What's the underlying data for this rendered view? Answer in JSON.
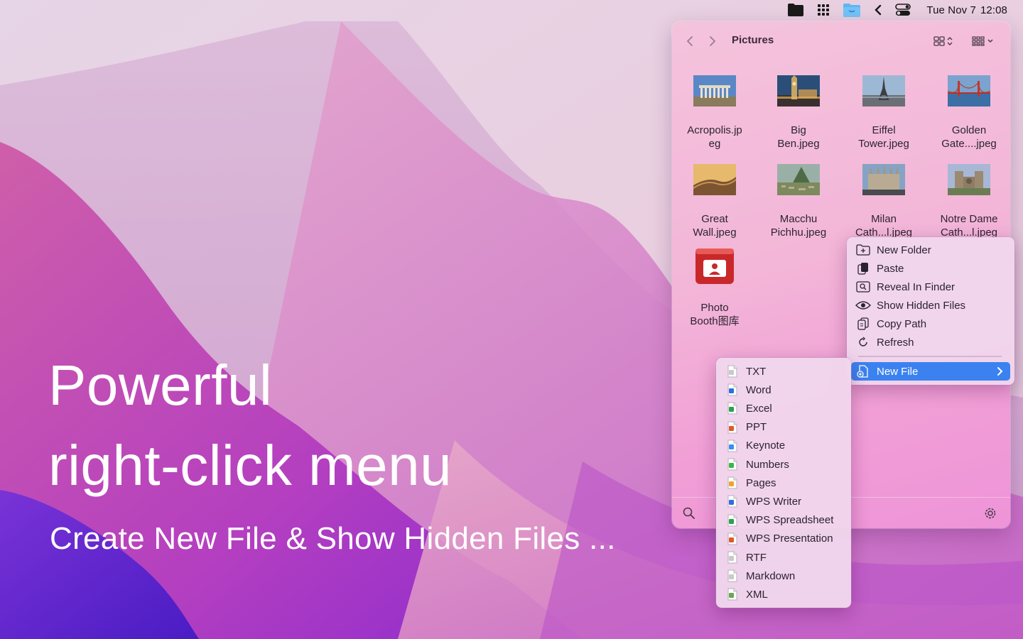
{
  "menubar": {
    "icons": [
      "folder-icon",
      "grid-dots-icon",
      "finder-icon",
      "chevron-left-icon",
      "control-center-icon"
    ],
    "date": "Tue Nov 7",
    "time": "12:08"
  },
  "hero": {
    "line1": "Powerful",
    "line2": "right-click menu",
    "subtitle": "Create New File & Show Hidden Files ..."
  },
  "window": {
    "title": "Pictures",
    "files": [
      {
        "label": "Acropolis.jp\neg",
        "thumb": "acropolis"
      },
      {
        "label": "Big\nBen.jpeg",
        "thumb": "bigben"
      },
      {
        "label": "Eiffel\nTower.jpeg",
        "thumb": "eiffel"
      },
      {
        "label": "Golden\nGate....jpeg",
        "thumb": "goldengate"
      },
      {
        "label": "Great\nWall.jpeg",
        "thumb": "greatwall"
      },
      {
        "label": "Macchu\nPichhu.jpeg",
        "thumb": "machu"
      },
      {
        "label": "Milan\nCath...l.jpeg",
        "thumb": "milan"
      },
      {
        "label": "Notre Dame\nCath...l.jpeg",
        "thumb": "notredame"
      },
      {
        "label": "Photo\nBooth图库",
        "thumb": "photobooth"
      }
    ]
  },
  "context_menu": {
    "items": [
      {
        "label": "New Folder",
        "icon": "new-folder-icon"
      },
      {
        "label": "Paste",
        "icon": "paste-icon"
      },
      {
        "label": "Reveal In Finder",
        "icon": "reveal-finder-icon"
      },
      {
        "label": "Show Hidden Files",
        "icon": "eye-icon"
      },
      {
        "label": "Copy Path",
        "icon": "copy-path-icon"
      },
      {
        "label": "Refresh",
        "icon": "refresh-icon"
      }
    ],
    "new_file": {
      "label": "New File",
      "icon": "new-file-icon"
    }
  },
  "new_file_menu": {
    "items": [
      {
        "label": "TXT",
        "color": "#c9c9c9"
      },
      {
        "label": "Word",
        "color": "#2f6de1"
      },
      {
        "label": "Excel",
        "color": "#2ea04f"
      },
      {
        "label": "PPT",
        "color": "#e2572c"
      },
      {
        "label": "Keynote",
        "color": "#3a8ef0"
      },
      {
        "label": "Numbers",
        "color": "#39b54a"
      },
      {
        "label": "Pages",
        "color": "#f2a130"
      },
      {
        "label": "WPS Writer",
        "color": "#2f6de1"
      },
      {
        "label": "WPS Spreadsheet",
        "color": "#2ea04f"
      },
      {
        "label": "WPS Presentation",
        "color": "#e2572c"
      },
      {
        "label": "RTF",
        "color": "#c9c9c9"
      },
      {
        "label": "Markdown",
        "color": "#c9c9c9"
      },
      {
        "label": "XML",
        "color": "#6aa84f"
      }
    ]
  }
}
